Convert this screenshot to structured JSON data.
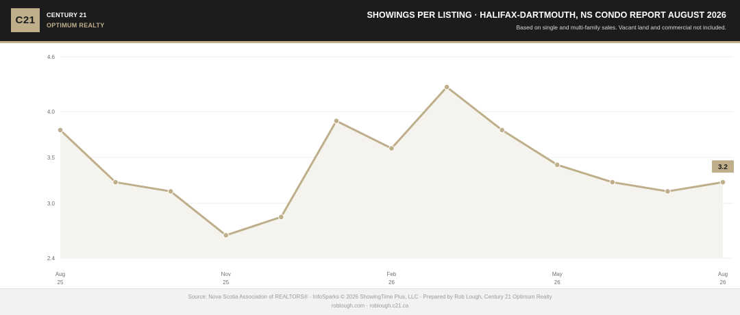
{
  "header": {
    "logo_text": "C21",
    "brand_name": "CENTURY 21",
    "brand_sub": "OPTIMUM REALTY",
    "title": "SHOWINGS PER LISTING  ·  HALIFAX-DARTMOUTH, NS CONDO REPORT AUGUST 2026",
    "subtitle": "Based on single and multi-family sales. Vacant land and commercial not included."
  },
  "footer": {
    "line1": "Source: Nova Scotia Association of REALTORS® · InfoSparks © 2026 ShowingTime Plus, LLC · Prepared by Rob Lough, Century 21 Optimum Realty",
    "line2": "roblough.com · roblough.c21.ca"
  },
  "colors": {
    "header_bg": "#1c1c1c",
    "accent": "#beae8a",
    "area_fill": "#f5f3ed",
    "grid": "#ececec"
  },
  "chart_data": {
    "type": "line",
    "title": "SHOWINGS PER LISTING",
    "x": [
      "Aug 25",
      "Sep 25",
      "Oct 25",
      "Nov 25",
      "Dec 25",
      "Jan 26",
      "Feb 26",
      "Mar 26",
      "Apr 26",
      "May 26",
      "Jun 26",
      "Jul 26",
      "Aug 26"
    ],
    "x_tick_labels": [
      {
        "index": 0,
        "month": "Aug",
        "year": "25"
      },
      {
        "index": 3,
        "month": "Nov",
        "year": "25"
      },
      {
        "index": 6,
        "month": "Feb",
        "year": "26"
      },
      {
        "index": 9,
        "month": "May",
        "year": "26"
      },
      {
        "index": 12,
        "month": "Aug",
        "year": "26"
      }
    ],
    "series": [
      {
        "values": [
          3.8,
          3.23,
          3.13,
          2.65,
          2.85,
          3.9,
          3.6,
          4.27,
          3.8,
          3.42,
          3.23,
          3.13,
          3.23
        ]
      }
    ],
    "y_ticks": [
      "4.6",
      "4.0",
      "3.5",
      "3.0",
      "2.4"
    ],
    "ylim": [
      2.4,
      4.6
    ],
    "last_value_label": "3.2",
    "grid": true,
    "area_fill": true
  }
}
